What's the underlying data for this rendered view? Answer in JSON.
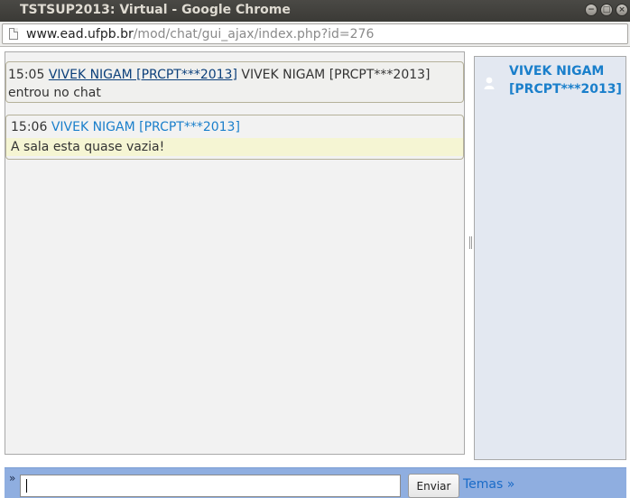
{
  "window": {
    "title": "TSTSUP2013: Virtual - Google Chrome",
    "buttons": {
      "minimize": "−",
      "maximize": "□",
      "close": "×"
    }
  },
  "address": {
    "host": "www.ead.ufpb.br",
    "path": "/mod/chat/gui_ajax/index.php?id=276"
  },
  "messages": [
    {
      "type": "system",
      "time": "15:05",
      "user": "VIVEK NIGAM [PRCPT***2013]",
      "text": "VIVEK NIGAM [PRCPT***2013] entrou no chat"
    },
    {
      "type": "user",
      "time": "15:06",
      "user": "VIVEK NIGAM [PRCPT***2013]",
      "text": "A sala esta quase vazia!"
    }
  ],
  "users": [
    {
      "name": "VIVEK NIGAM [PRCPT***2013]",
      "icon": "user-avatar-icon"
    }
  ],
  "input": {
    "prompt": "»",
    "value": "",
    "send_label": "Enviar",
    "themes_label": "Temas »"
  },
  "colors": {
    "user_name": "#1a7fcb",
    "input_bar": "#8faee0",
    "users_panel": "#e3e8f1",
    "message_highlight": "#f5f5d3"
  }
}
